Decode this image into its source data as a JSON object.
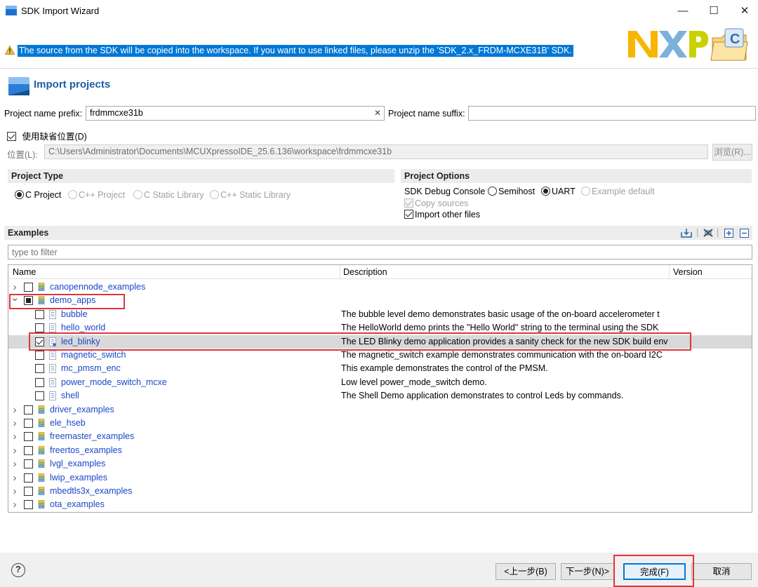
{
  "window": {
    "title": "SDK Import Wizard",
    "minimize": "—",
    "maximize": "☐",
    "close": "✕"
  },
  "banner": {
    "text": "The source from the SDK will be copied into the workspace. If you want to use linked files, please unzip the 'SDK_2.x_FRDM-MCXE31B' SDK."
  },
  "logo": {
    "text": "NXP"
  },
  "page": {
    "title": "Import projects"
  },
  "form": {
    "prefix_label": "Project name prefix:",
    "prefix_value": "frdmmcxe31b",
    "clear_glyph": "✕",
    "suffix_label": "Project name suffix:",
    "suffix_value": "",
    "default_loc_label": "使用缺省位置(D)",
    "location_label": "位置(L):",
    "location_value": "C:\\Users\\Administrator\\Documents\\MCUXpressoIDE_25.6.136\\workspace\\frdmmcxe31b",
    "browse_label": "浏览(R)..."
  },
  "project_type": {
    "header": "Project Type",
    "options": [
      "C Project",
      "C++ Project",
      "C Static Library",
      "C++ Static Library"
    ]
  },
  "project_options": {
    "header": "Project Options",
    "console_label": "SDK Debug Console",
    "console_options": [
      "Semihost",
      "UART",
      "Example default"
    ],
    "copy_sources": "Copy sources",
    "import_other": "Import other files"
  },
  "examples": {
    "header": "Examples",
    "filter_placeholder": "type to filter",
    "columns": [
      "Name",
      "Description",
      "Version"
    ],
    "rows": [
      {
        "name": "canopennode_examples",
        "desc": ""
      },
      {
        "name": "demo_apps",
        "desc": ""
      },
      {
        "name": "bubble",
        "desc": "The bubble level demo demonstrates basic usage of the on-board accelerometer t"
      },
      {
        "name": "hello_world",
        "desc": "The HelloWorld demo prints the \"Hello World\" string to the terminal using the SDK"
      },
      {
        "name": "led_blinky",
        "desc": "The LED Blinky demo application provides a sanity check for the new SDK build env"
      },
      {
        "name": "magnetic_switch",
        "desc": "The magnetic_switch example demonstrates communication with the on-board I2C"
      },
      {
        "name": "mc_pmsm_enc",
        "desc": "This example demonstrates the control of the PMSM."
      },
      {
        "name": "power_mode_switch_mcxe",
        "desc": "Low level power_mode_switch demo."
      },
      {
        "name": "shell",
        "desc": "The Shell Demo application demonstrates to control Leds by commands."
      },
      {
        "name": "driver_examples",
        "desc": ""
      },
      {
        "name": "ele_hseb",
        "desc": ""
      },
      {
        "name": "freemaster_examples",
        "desc": ""
      },
      {
        "name": "freertos_examples",
        "desc": ""
      },
      {
        "name": "lvgl_examples",
        "desc": ""
      },
      {
        "name": "lwip_examples",
        "desc": ""
      },
      {
        "name": "mbedtls3x_examples",
        "desc": ""
      },
      {
        "name": "ota_examples",
        "desc": ""
      }
    ]
  },
  "footer": {
    "help": "?",
    "back": "<上一步(B)",
    "next": "下一步(N)>",
    "finish": "完成(F)",
    "cancel": "取消"
  },
  "colors": {
    "accent": "#0078d7",
    "link": "#1a47c9",
    "highlight": "#e0353b"
  }
}
